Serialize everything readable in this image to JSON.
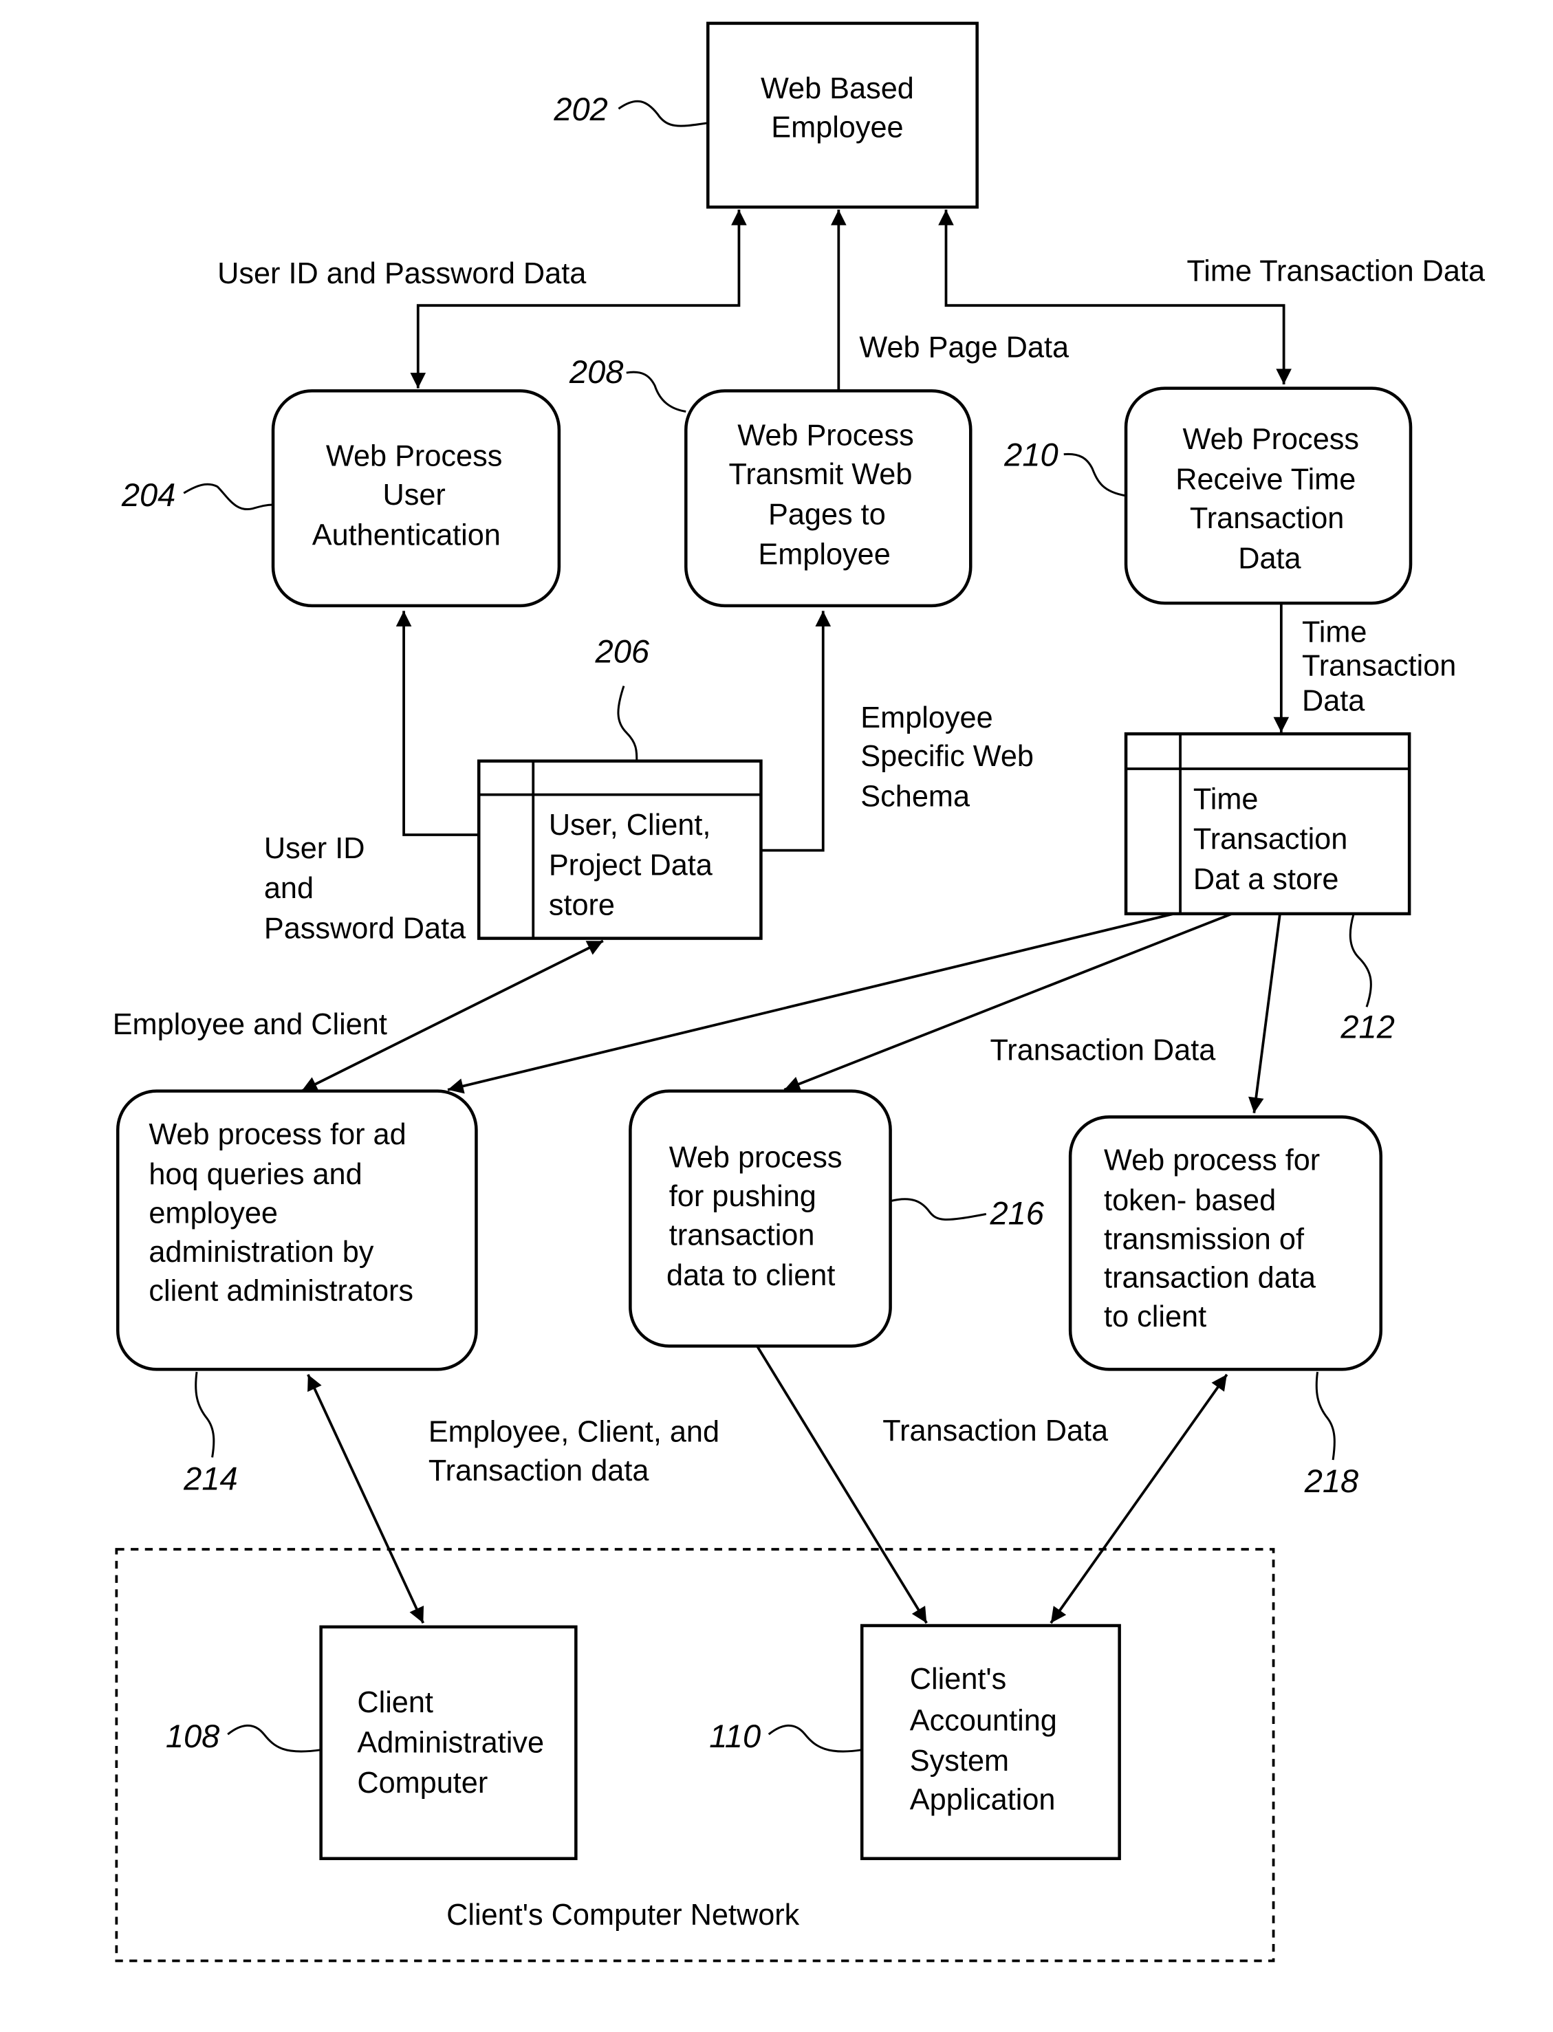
{
  "nodes": {
    "n202": {
      "ref": "202",
      "lines": [
        "Web Based",
        "Employee"
      ]
    },
    "n204": {
      "ref": "204",
      "lines": [
        "Web Process",
        "User",
        "Authentication"
      ]
    },
    "n208": {
      "ref": "208",
      "lines": [
        "Web Process",
        "Transmit Web",
        "Pages to",
        "Employee"
      ]
    },
    "n210": {
      "ref": "210",
      "lines": [
        "Web Process",
        "Receive Time",
        "Transaction",
        "Data"
      ]
    },
    "n206": {
      "ref": "206",
      "lines": [
        "User, Client,",
        "Project Data",
        "store"
      ]
    },
    "n212": {
      "ref": "212",
      "lines": [
        "Time",
        "Transaction",
        "Dat a store"
      ]
    },
    "n214": {
      "ref": "214",
      "lines": [
        "Web process for ad",
        "hoq queries and",
        "employee",
        "administration by",
        "client administrators"
      ]
    },
    "n216": {
      "ref": "216",
      "lines": [
        "Web process",
        "for pushing",
        "transaction",
        "data to client"
      ]
    },
    "n218": {
      "ref": "218",
      "lines": [
        "Web process for",
        "token- based",
        "transmission of",
        "transaction data",
        "to client"
      ]
    },
    "n108": {
      "ref": "108",
      "lines": [
        "Client",
        "Administrative",
        "Computer"
      ]
    },
    "n110": {
      "ref": "110",
      "lines": [
        "Client's",
        "Accounting",
        "System",
        "Application"
      ]
    }
  },
  "flows": {
    "userid_password_top": "User ID and Password Data",
    "time_transaction_top": "Time Transaction Data",
    "web_page_data": "Web Page Data",
    "employee_schema": [
      "Employee",
      "Specific Web",
      "Schema"
    ],
    "userid_password_left": [
      "User ID",
      "and",
      "Password Data"
    ],
    "time_transaction_down": [
      "Time",
      "Transaction",
      "Data"
    ],
    "employee_and_client": "Employee and Client",
    "transaction_data_mid": "Transaction Data",
    "emp_client_trans": [
      "Employee, Client, and",
      "Transaction data"
    ],
    "transaction_data_low": "Transaction Data"
  },
  "network": {
    "label": "Client's Computer Network"
  }
}
